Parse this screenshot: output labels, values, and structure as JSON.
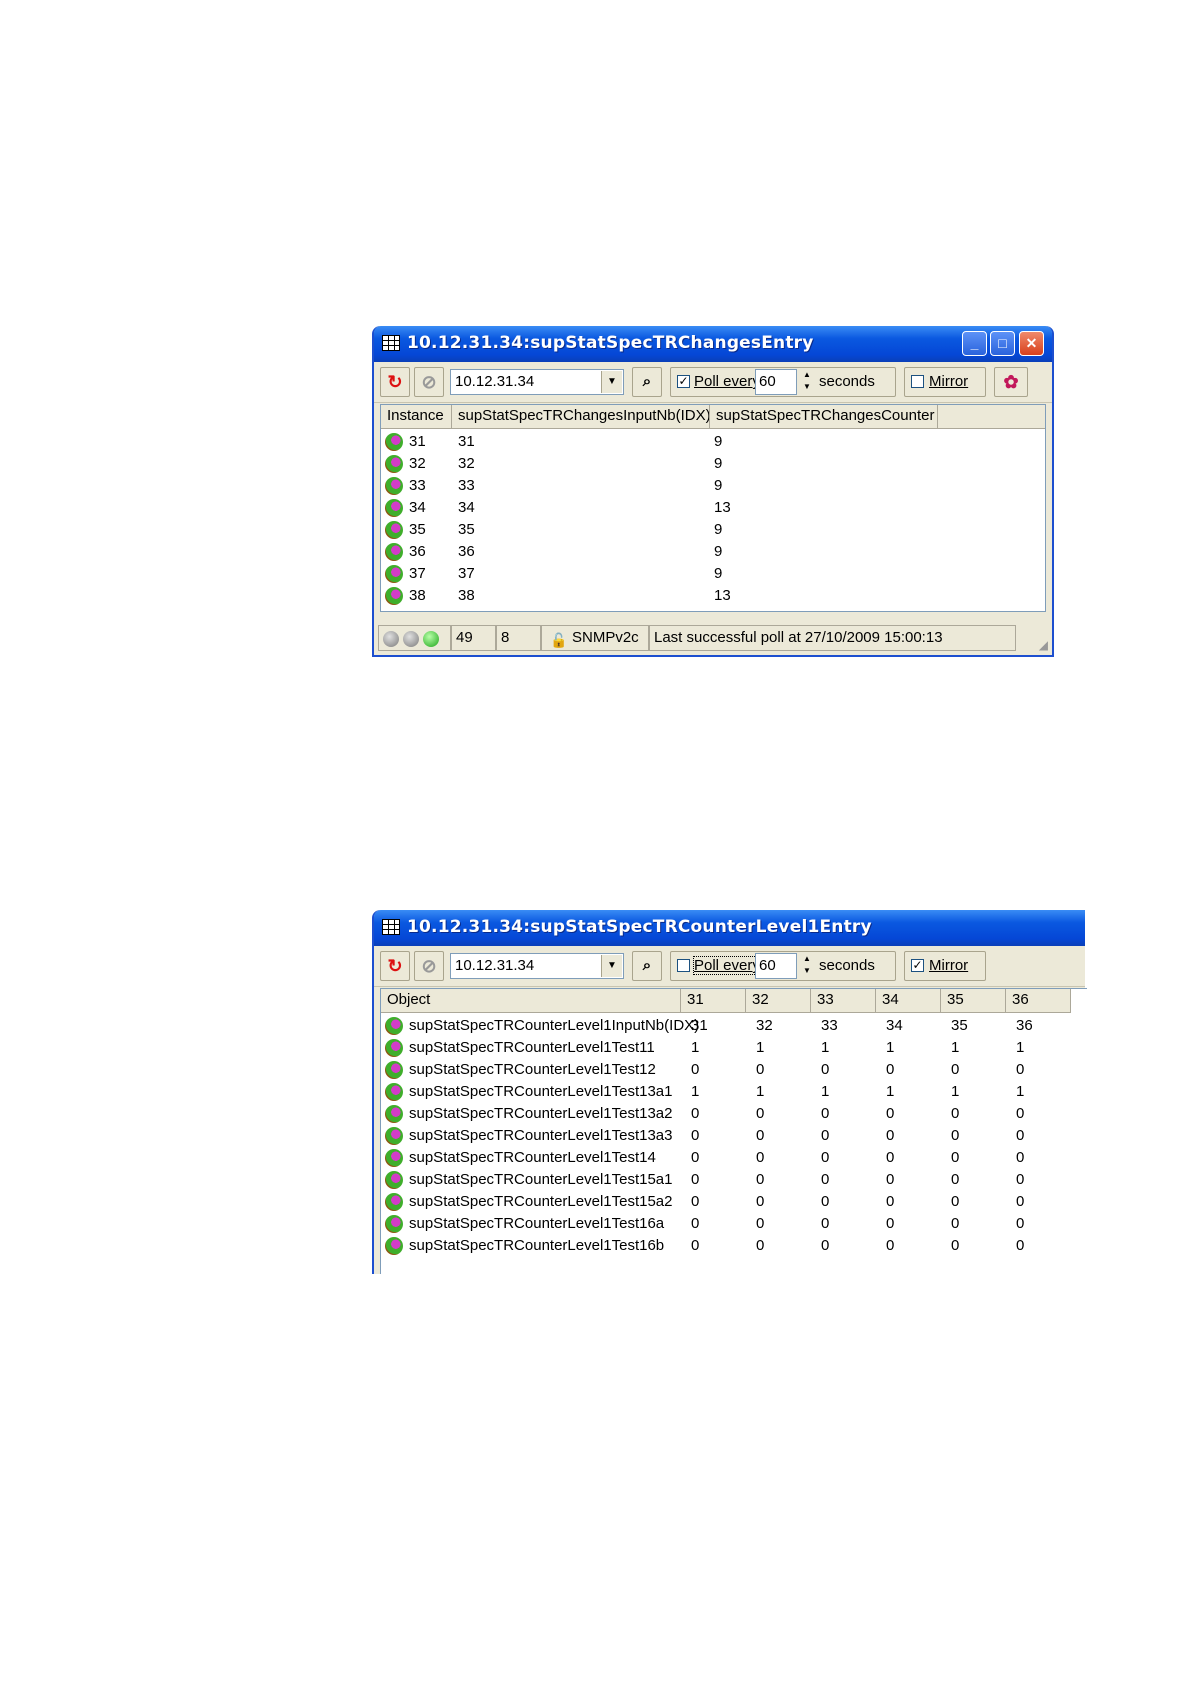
{
  "window1": {
    "title": "10.12.31.34:supStatSpecTRChangesEntry",
    "agent": "10.12.31.34",
    "poll_checked": true,
    "poll_label": "Poll every",
    "poll_value": "60",
    "seconds_label": "seconds",
    "mirror_checked": false,
    "mirror_label": "Mirror",
    "columns": [
      "Instance",
      "supStatSpecTRChangesInputNb(IDX)",
      "supStatSpecTRChangesCounter"
    ],
    "rows": [
      [
        "31",
        "31",
        "9"
      ],
      [
        "32",
        "32",
        "9"
      ],
      [
        "33",
        "33",
        "9"
      ],
      [
        "34",
        "34",
        "13"
      ],
      [
        "35",
        "35",
        "9"
      ],
      [
        "36",
        "36",
        "9"
      ],
      [
        "37",
        "37",
        "9"
      ],
      [
        "38",
        "38",
        "13"
      ]
    ],
    "status": {
      "count1": "49",
      "count2": "8",
      "protocol": "SNMPv2c",
      "message": "Last successful poll at 27/10/2009 15:00:13"
    }
  },
  "window2": {
    "title": "10.12.31.34:supStatSpecTRCounterLevel1Entry",
    "agent": "10.12.31.34",
    "poll_checked": false,
    "poll_label": "Poll every",
    "poll_value": "60",
    "seconds_label": "seconds",
    "mirror_checked": true,
    "mirror_label": "Mirror",
    "columns": [
      "Object",
      "31",
      "32",
      "33",
      "34",
      "35",
      "36"
    ],
    "rows": [
      [
        "supStatSpecTRCounterLevel1InputNb(IDX)",
        "31",
        "32",
        "33",
        "34",
        "35",
        "36"
      ],
      [
        "supStatSpecTRCounterLevel1Test11",
        "1",
        "1",
        "1",
        "1",
        "1",
        "1"
      ],
      [
        "supStatSpecTRCounterLevel1Test12",
        "0",
        "0",
        "0",
        "0",
        "0",
        "0"
      ],
      [
        "supStatSpecTRCounterLevel1Test13a1",
        "1",
        "1",
        "1",
        "1",
        "1",
        "1"
      ],
      [
        "supStatSpecTRCounterLevel1Test13a2",
        "0",
        "0",
        "0",
        "0",
        "0",
        "0"
      ],
      [
        "supStatSpecTRCounterLevel1Test13a3",
        "0",
        "0",
        "0",
        "0",
        "0",
        "0"
      ],
      [
        "supStatSpecTRCounterLevel1Test14",
        "0",
        "0",
        "0",
        "0",
        "0",
        "0"
      ],
      [
        "supStatSpecTRCounterLevel1Test15a1",
        "0",
        "0",
        "0",
        "0",
        "0",
        "0"
      ],
      [
        "supStatSpecTRCounterLevel1Test15a2",
        "0",
        "0",
        "0",
        "0",
        "0",
        "0"
      ],
      [
        "supStatSpecTRCounterLevel1Test16a",
        "0",
        "0",
        "0",
        "0",
        "0",
        "0"
      ],
      [
        "supStatSpecTRCounterLevel1Test16b",
        "0",
        "0",
        "0",
        "0",
        "0",
        "0"
      ]
    ]
  }
}
